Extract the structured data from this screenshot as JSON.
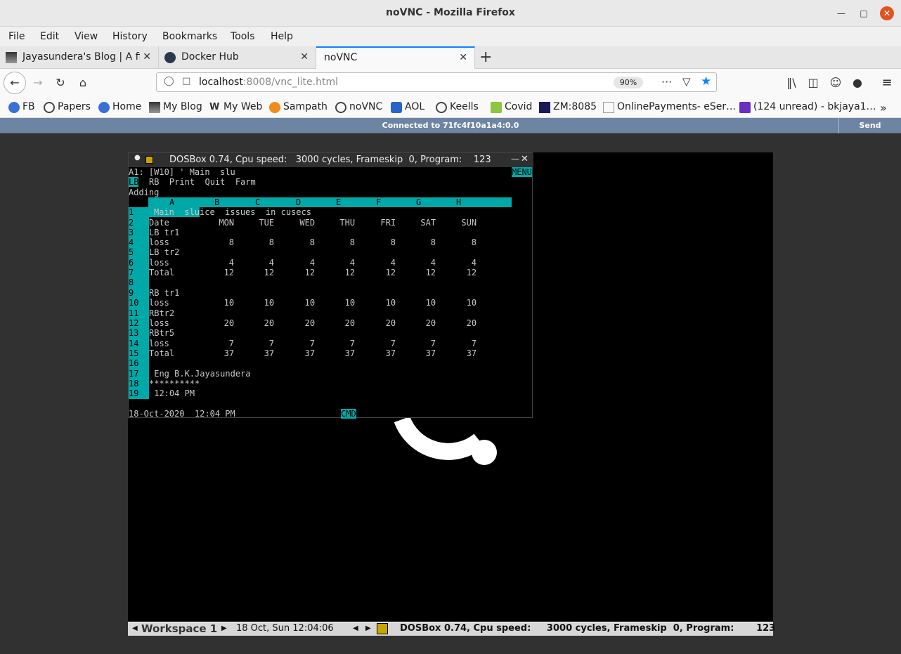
{
  "window": {
    "title": "noVNC - Mozilla Firefox"
  },
  "menu": [
    "File",
    "Edit",
    "View",
    "History",
    "Bookmarks",
    "Tools",
    "Help"
  ],
  "tabs": [
    {
      "label": "Jayasundera's Blog | A fir"
    },
    {
      "label": "Docker Hub"
    },
    {
      "label": "noVNC"
    }
  ],
  "nav": {
    "url_host": "localhost",
    "url_rest": ":8008/vnc_lite.html",
    "zoom": "90%"
  },
  "bookmarks": [
    "FB",
    "Papers",
    "Home",
    "My Blog",
    "My Web",
    "Sampath",
    "noVNC",
    "AOL",
    "Keells",
    "Covid",
    "ZM:8085",
    "OnlinePayments- eSer…",
    "(124 unread) - bkjaya1…"
  ],
  "novnc": {
    "status": "Connected to 71fc4f10a1a4:0.0",
    "ctrl_alt_del": "Send CtrlAltDel"
  },
  "dosbox": {
    "title": "DOSBox 0.74, Cpu speed:   3000 cycles, Frameskip  0, Program:    123",
    "line1": "A1: [W10] ' Main  slu",
    "menu_badge": "MENU",
    "commands": [
      "LB",
      "RB  Print  Quit  Farm"
    ],
    "mode_line": "Adding",
    "columns": [
      "A",
      "B",
      "C",
      "D",
      "E",
      "F",
      "G",
      "H"
    ],
    "sheet_title": "Main  sluice  issues  in cusecs",
    "headers": [
      "Date",
      "MON",
      "TUE",
      "WED",
      "THU",
      "FRI",
      "SAT",
      "SUN"
    ],
    "rows": [
      {
        "n": "3",
        "label": "LB tr1",
        "vals": []
      },
      {
        "n": "4",
        "label": "loss",
        "vals": [
          "8",
          "8",
          "8",
          "8",
          "8",
          "8",
          "8"
        ]
      },
      {
        "n": "5",
        "label": "LB tr2",
        "vals": []
      },
      {
        "n": "6",
        "label": "loss",
        "vals": [
          "4",
          "4",
          "4",
          "4",
          "4",
          "4",
          "4"
        ]
      },
      {
        "n": "7",
        "label": "Total",
        "vals": [
          "12",
          "12",
          "12",
          "12",
          "12",
          "12",
          "12"
        ]
      },
      {
        "n": "8",
        "label": "",
        "vals": []
      },
      {
        "n": "9",
        "label": "RB tr1",
        "vals": []
      },
      {
        "n": "10",
        "label": "loss",
        "vals": [
          "10",
          "10",
          "10",
          "10",
          "10",
          "10",
          "10"
        ]
      },
      {
        "n": "11",
        "label": "RBtr2",
        "vals": []
      },
      {
        "n": "12",
        "label": "loss",
        "vals": [
          "20",
          "20",
          "20",
          "20",
          "20",
          "20",
          "20"
        ]
      },
      {
        "n": "13",
        "label": "RBtr5",
        "vals": []
      },
      {
        "n": "14",
        "label": "loss",
        "vals": [
          "7",
          "7",
          "7",
          "7",
          "7",
          "7",
          "7"
        ]
      },
      {
        "n": "15",
        "label": "Total",
        "vals": [
          "37",
          "37",
          "37",
          "37",
          "37",
          "37",
          "37"
        ]
      },
      {
        "n": "16",
        "label": "",
        "vals": []
      },
      {
        "n": "17",
        "label": " Eng B.K.Jayasundera",
        "vals": []
      },
      {
        "n": "18",
        "label": "**********",
        "vals": []
      },
      {
        "n": "19",
        "label": " 12:04 PM",
        "vals": []
      },
      {
        "n": "20",
        "label": "",
        "vals": []
      }
    ],
    "status_date": "18-Oct-2020  12:04 PM",
    "status_mode": "CMD"
  },
  "taskbar": {
    "workspace": "Workspace 1",
    "clock": "18 Oct, Sun 12:04:06",
    "app_title": "DOSBox 0.74, Cpu speed:     3000 cycles, Frameskip  0, Program:       123"
  }
}
